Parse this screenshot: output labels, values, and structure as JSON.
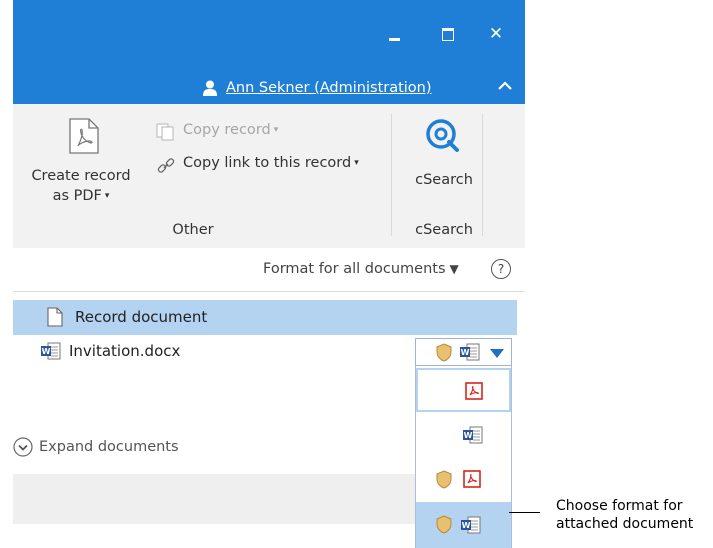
{
  "window": {
    "minimize_icon": "minimize-icon",
    "maximize_icon": "maximize-icon",
    "close_glyph": "✕",
    "user_name": "Ann Sekner (Administration)",
    "collapse_glyph": "⌃"
  },
  "ribbon": {
    "create_pdf_line1": "Create record",
    "create_pdf_line2": "as PDF",
    "copy_record": "Copy record",
    "copy_link": "Copy link to this record",
    "csearch_button": "cSearch",
    "group_other": "Other",
    "group_csearch": "cSearch",
    "caret": "▾"
  },
  "format_bar": {
    "label": "Format for all documents",
    "arrow": "▼",
    "help": "?"
  },
  "documents": {
    "record_document": "Record document",
    "attachment": "Invitation.docx",
    "expand": "Expand documents"
  },
  "format_options": [
    "pdf",
    "word",
    "signed-pdf",
    "signed-word"
  ],
  "selected_option_index": 3,
  "callout": {
    "line1": "Choose format for",
    "line2": "attached document"
  },
  "colors": {
    "titlebar": "#1f7fd6",
    "selection": "#b3d3f0",
    "pdf_red": "#d9261c",
    "word_blue": "#2b579a",
    "shield": "#e8c070"
  }
}
